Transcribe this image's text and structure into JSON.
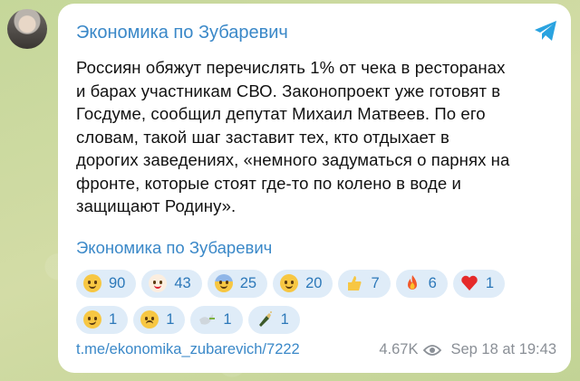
{
  "channel": {
    "name": "Экономика по Зубаревич"
  },
  "post": {
    "text": "Россиян обяжут перечислять 1% от чека в ресторанах\nи барах участникам СВО. Законопроект уже готовят в\nГосдуме, сообщил депутат Михаил Матвеев. По его\nсловам, такой шаг заставит тех, кто отдыхает в\nдорогих заведениях, «немного задуматься о парнях на\nфронте, которые стоят где-то по колено в воде и\nзащищают Родину».",
    "signature_link": "Экономика по Зубаревич"
  },
  "reactions": [
    {
      "emoji": "exploding-head",
      "count": "90"
    },
    {
      "emoji": "clown-face",
      "count": "43"
    },
    {
      "emoji": "screaming-face",
      "count": "25"
    },
    {
      "emoji": "rofl-face",
      "count": "20"
    },
    {
      "emoji": "thumbs-up",
      "count": "7"
    },
    {
      "emoji": "fire",
      "count": "6"
    },
    {
      "emoji": "red-heart",
      "count": "1"
    },
    {
      "emoji": "thinking-face",
      "count": "1"
    },
    {
      "emoji": "crying-face",
      "count": "1"
    },
    {
      "emoji": "dove",
      "count": "1"
    },
    {
      "emoji": "champagne",
      "count": "1"
    }
  ],
  "footer": {
    "link": "t.me/ekonomika_zubarevich/7222",
    "views": "4.67K",
    "date": "Sep 18 at 19:43"
  },
  "colors": {
    "accent": "#3a88c8",
    "chip_bg": "#dfecf8",
    "telegram": "#2aa3e0"
  }
}
